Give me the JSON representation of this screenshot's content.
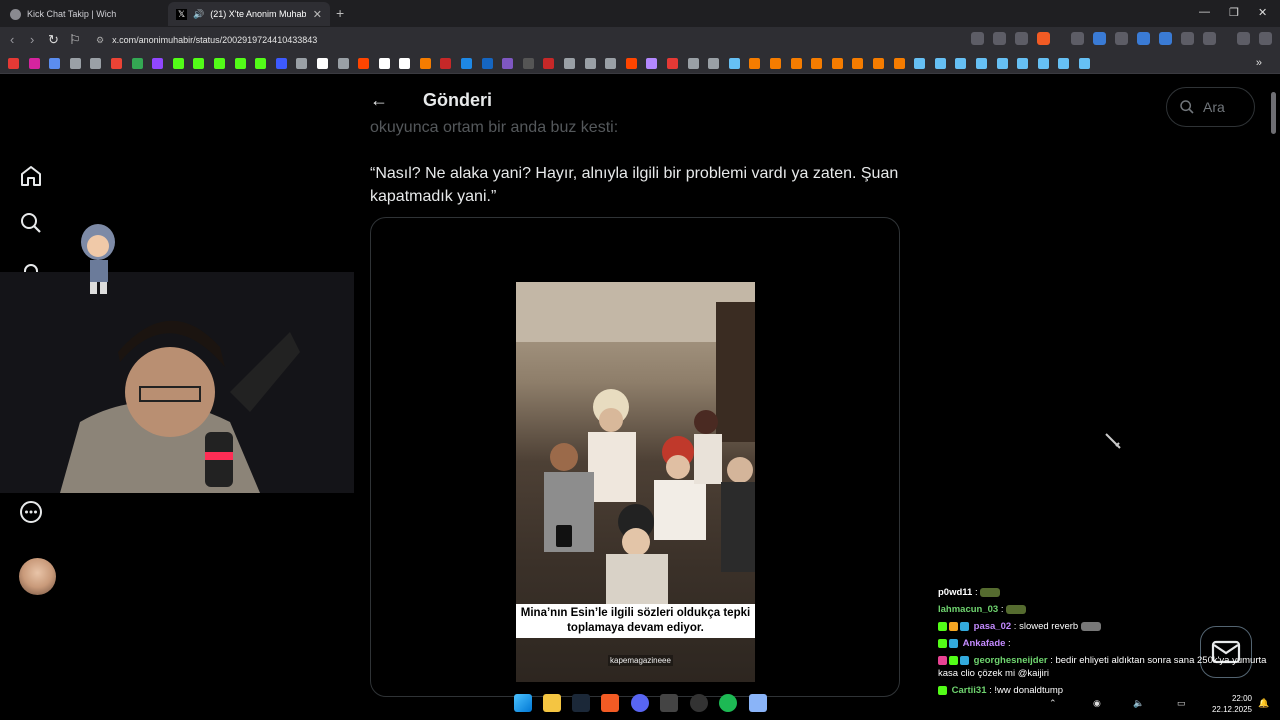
{
  "browser": {
    "tabs": [
      {
        "title": "Kick Chat Takip | Wich"
      },
      {
        "title": "(21) X'te Anonim Muhabir: \"M"
      }
    ],
    "new_tab": "+",
    "url": "x.com/anonimuhabir/status/2002919724410433843",
    "window_controls": {
      "minimize": "—",
      "restore": "❐",
      "close": "✕"
    },
    "more_bookmarks": "»"
  },
  "page": {
    "header_title": "Gönderi",
    "back_icon": "arrow-left-icon",
    "tweet_partial_line": "okuyunca ortam bir anda buz kesti:",
    "tweet_quote": "“Nasıl? Ne alaka yani? Hayır, alnıyla ilgili bir problemi vardı ya zaten. Şuan kapatmadık yani.”",
    "video_caption": "Mina’nın Esin’le ilgili sözleri oldukça tepki toplamaya devam ediyor.",
    "video_watermark": "kapemagazineee",
    "search_placeholder": "Ara"
  },
  "chat": [
    {
      "user": "p0wd11",
      "sep": " :",
      "text": "",
      "color": "#dcdcdc",
      "emote": true
    },
    {
      "user": "lahmacun_03",
      "sep": " :",
      "text": "",
      "color": "#6fd46f",
      "emote": true
    },
    {
      "user": "pasa_02",
      "sep": " :",
      "text": " slowed reverb",
      "color": "#c48bff",
      "emote": true
    },
    {
      "user": "Ankafade",
      "sep": " :",
      "text": "",
      "color": "#c48bff",
      "emote": false
    },
    {
      "user": "georghesneijder",
      "sep": " :",
      "text": " bedir ehliyeti aldıktan sonra sana 250k'ya yumurta kasa clio çözek mi @kaijiri",
      "color": "#6fd46f",
      "emote": false
    },
    {
      "user": "Cartii31",
      "sep": " :",
      "text": " !ww donaldtump",
      "color": "#6fd46f",
      "emote": false
    }
  ],
  "taskbar": {
    "time": "22:00",
    "date": "22.12.2025"
  },
  "colors": {
    "background": "#000000",
    "text": "#e7e9ea",
    "border": "#2f3336",
    "chrome": "#2e2e33"
  }
}
